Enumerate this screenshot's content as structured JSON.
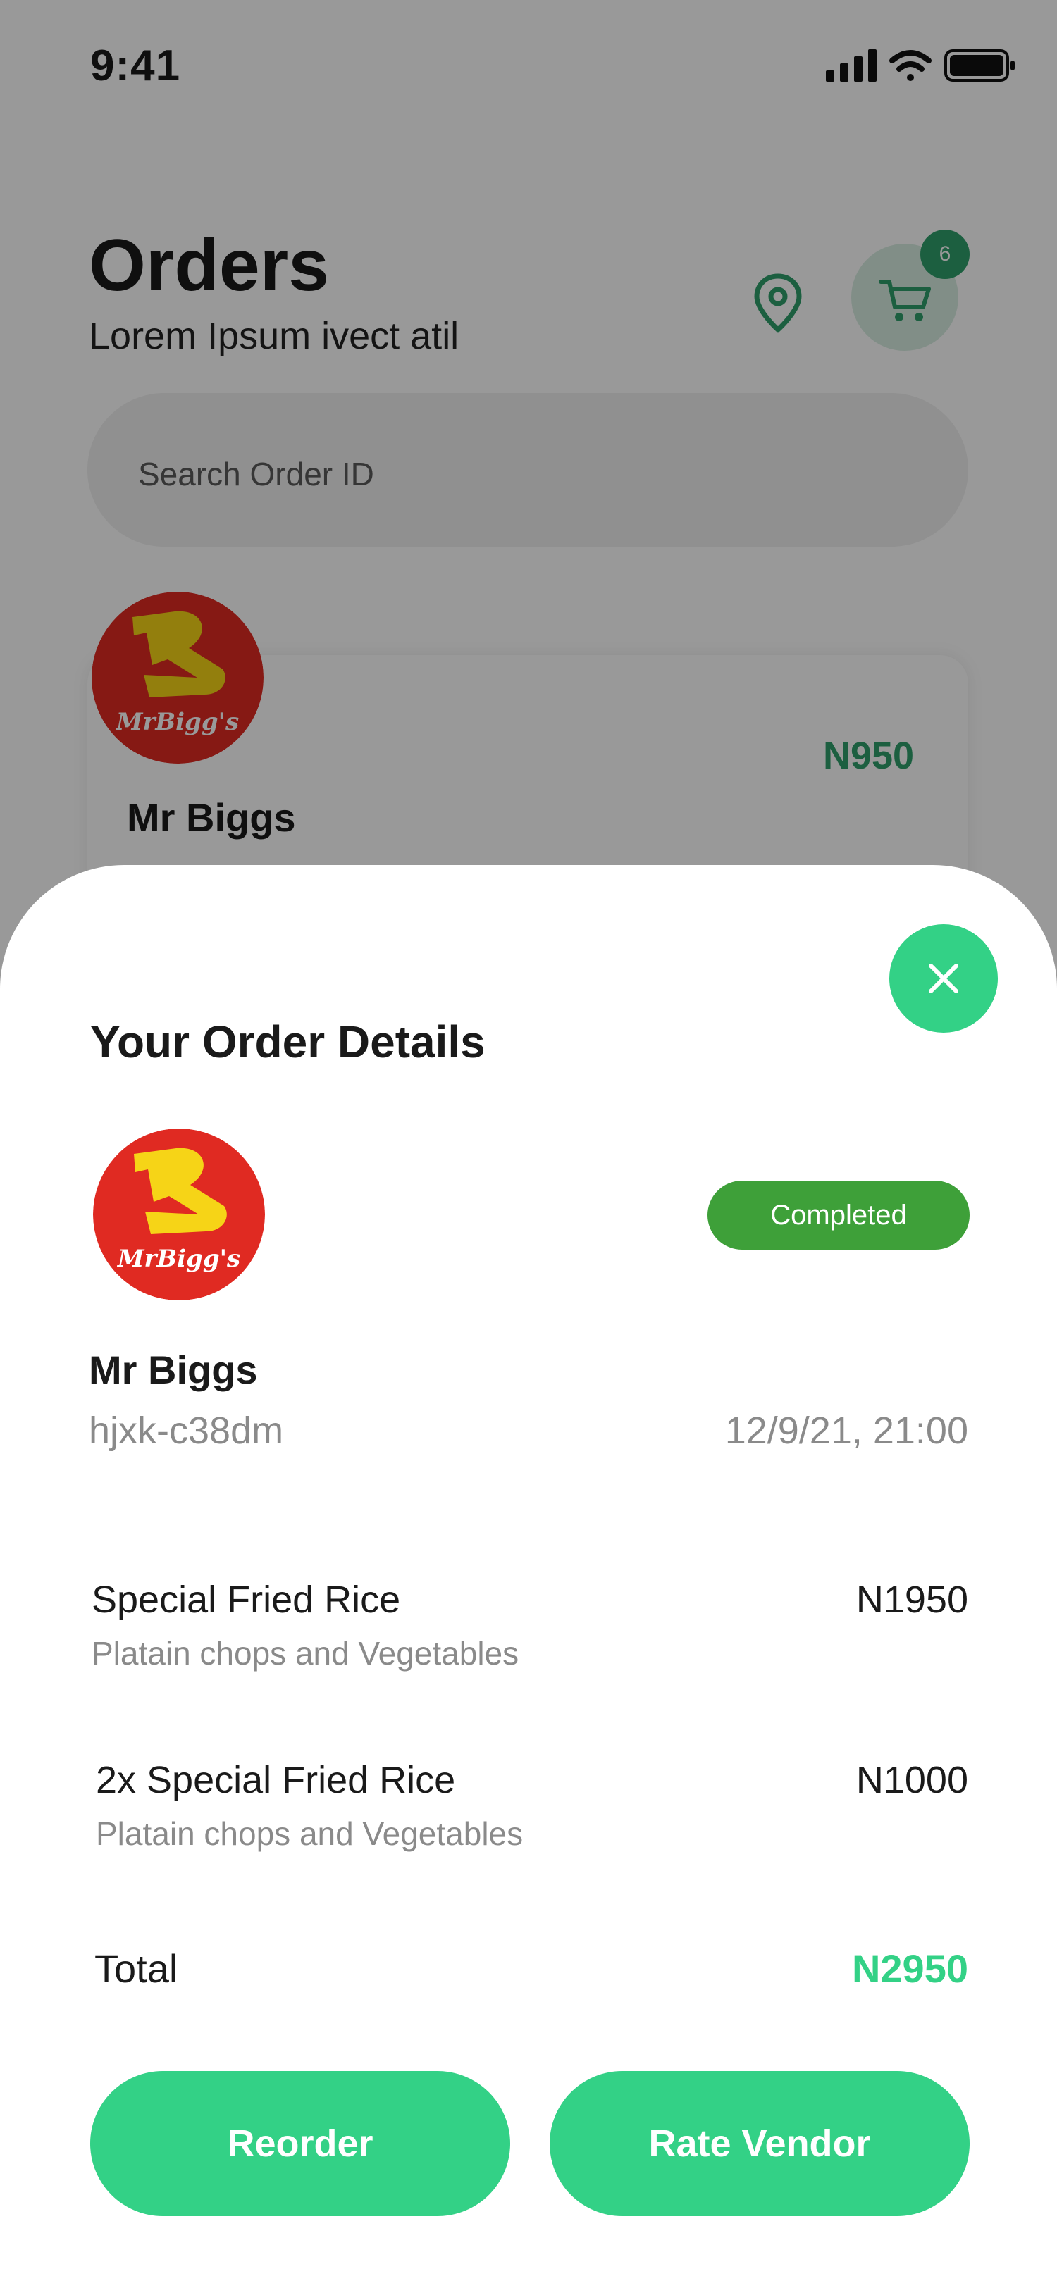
{
  "status_bar": {
    "time": "9:41"
  },
  "header": {
    "title": "Orders",
    "subtitle": "Lorem Ipsum ivect atil",
    "cart_count": "6"
  },
  "search": {
    "placeholder": "Search Order ID"
  },
  "order_card": {
    "vendor": "Mr Biggs",
    "price": "N950"
  },
  "logo": {
    "text": "MrBigg's",
    "letter": "B",
    "bg_color": "#e02a22",
    "fg_color": "#f6d417"
  },
  "sheet": {
    "title": "Your Order Details",
    "status": "Completed",
    "vendor": "Mr Biggs",
    "order_id": "hjxk-c38dm",
    "date": "12/9/21, 21:00",
    "items": [
      {
        "name": "Special Fried Rice",
        "desc": "Platain chops and Vegetables",
        "price": "N1950"
      },
      {
        "name": "2x Special Fried Rice",
        "desc": "Platain chops and Vegetables",
        "price": "N1000"
      }
    ],
    "total_label": "Total",
    "total_value": "N2950",
    "reorder_label": "Reorder",
    "rate_label": "Rate Vendor"
  },
  "colors": {
    "accent": "#33d186",
    "status_green": "#3ea039",
    "price_green": "#2f9e6b"
  },
  "icons": {
    "location": "map-pin-icon",
    "cart": "shopping-cart-icon",
    "close": "close-icon"
  }
}
